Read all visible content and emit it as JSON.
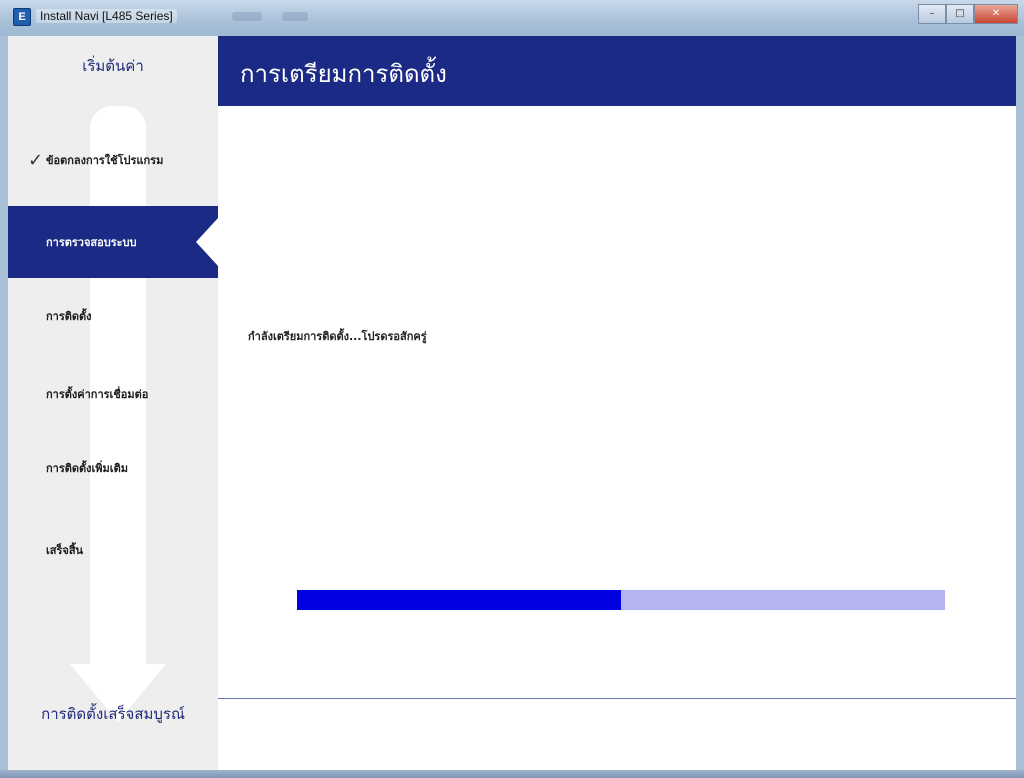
{
  "window": {
    "title": "Install Navi [L485 Series]",
    "icon_letter": "E",
    "buttons": {
      "minimize": "–",
      "maximize": "□",
      "close": "✕"
    }
  },
  "sidebar": {
    "start_label": "เริ่มต้นค่า",
    "steps": [
      {
        "label": "ข้อตกลงการใช้โปรแกรม",
        "state": "done"
      },
      {
        "label": "การตรวจสอบระบบ",
        "state": "active"
      },
      {
        "label": "การติดตั้ง",
        "state": "pending"
      },
      {
        "label": "การตั้งค่าการเชื่อมต่อ",
        "state": "pending"
      },
      {
        "label": "การติดตั้งเพิ่มเติม",
        "state": "pending"
      },
      {
        "label": "เสร็จสิ้น",
        "state": "pending"
      }
    ],
    "complete_label": "การติดตั้งเสร็จสมบูรณ์"
  },
  "main": {
    "title": "การเตรียมการติดตั้ง",
    "status": "กำลังเตรียมการติดตั้ง...โปรดรอสักครู่",
    "progress_fraction": 0.5
  },
  "colors": {
    "accent": "#1a2a85",
    "progress_fill": "#0000e0",
    "progress_track": "#b4b4f0",
    "sidebar_bg": "#eeeeee"
  },
  "icons": {
    "app": "epson-e-icon",
    "done_check": "checkmark-icon",
    "flow_arrow": "down-arrow-icon"
  }
}
